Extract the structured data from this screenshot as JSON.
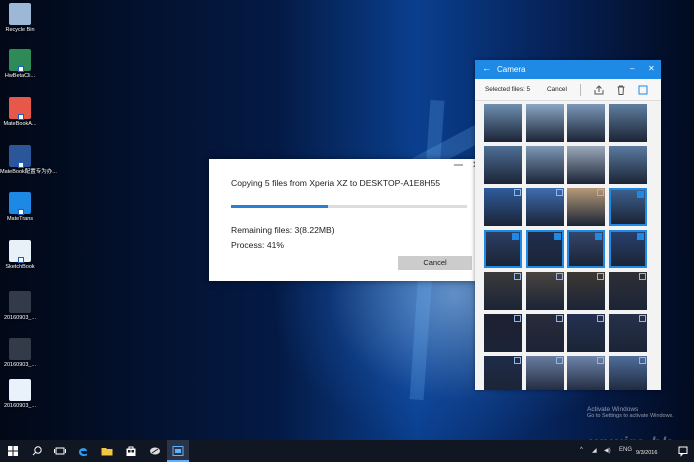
{
  "desktop": {
    "icons": [
      {
        "label": "Recycle Bin",
        "icon": "recycle-bin-icon",
        "color": "#9cb8d6"
      },
      {
        "label": "HwBetaCli...",
        "icon": "app-icon",
        "color": "#2e8b57"
      },
      {
        "label": "MateBookA...",
        "icon": "app-icon",
        "color": "#e8584a"
      },
      {
        "label": "MateBook配置专为办...",
        "icon": "word-document-icon",
        "color": "#2b579a"
      },
      {
        "label": "MateTrans",
        "icon": "app-icon",
        "color": "#1e88e5"
      },
      {
        "label": "SketchBook",
        "icon": "app-icon",
        "color": "#e8f0f8"
      },
      {
        "label": "20160903_...",
        "icon": "photo-icon",
        "color": "#333a48"
      },
      {
        "label": "20160903_...",
        "icon": "photo-icon",
        "color": "#333a48"
      },
      {
        "label": "20160903_...",
        "icon": "image-file-icon",
        "color": "#e9f2fb"
      }
    ]
  },
  "copy_dialog": {
    "title": "Copying 5 files from Xperia XZ to DESKTOP-A1E8H55",
    "progress": 0.41,
    "remaining": "Remaining files: 3(8.22MB)",
    "process": "Process: 41%",
    "cancel_label": "Cancel",
    "close_glyph": "✕"
  },
  "camera_window": {
    "title": "Camera",
    "back_glyph": "←",
    "minimize_glyph": "–",
    "close_glyph": "✕",
    "selected_files": "Selected files: 5",
    "cancel_label": "Cancel",
    "accent": "#1e8ae6",
    "thumbnails": [
      {
        "color": "#6e8fb0",
        "selected": false
      },
      {
        "color": "#8aa7c4",
        "selected": false
      },
      {
        "color": "#7b98b8",
        "selected": false
      },
      {
        "color": "#5f7e9f",
        "selected": false
      },
      {
        "color": "#4e6f96",
        "selected": false
      },
      {
        "color": "#7d97b6",
        "selected": false
      },
      {
        "color": "#9aa9bb",
        "selected": false
      },
      {
        "color": "#5b7aa0",
        "selected": false
      },
      {
        "color": "#2f5c9c",
        "selected": false
      },
      {
        "color": "#3e6db0",
        "selected": false
      },
      {
        "color": "#b59a78",
        "selected": false
      },
      {
        "color": "#3d5f8c",
        "selected": true
      },
      {
        "color": "#2d3f63",
        "selected": true
      },
      {
        "color": "#1f2e4f",
        "selected": true
      },
      {
        "color": "#34466a",
        "selected": true
      },
      {
        "color": "#28406e",
        "selected": true
      },
      {
        "color": "#3b3a3a",
        "selected": false
      },
      {
        "color": "#4a4440",
        "selected": false
      },
      {
        "color": "#3d3834",
        "selected": false
      },
      {
        "color": "#2f2f35",
        "selected": false
      },
      {
        "color": "#1e2030",
        "selected": false
      },
      {
        "color": "#2a2b3b",
        "selected": false
      },
      {
        "color": "#243050",
        "selected": false
      },
      {
        "color": "#26304a",
        "selected": false
      },
      {
        "color": "#1f2c48",
        "selected": false
      },
      {
        "color": "#6a7da0",
        "selected": false
      },
      {
        "color": "#6e84aa",
        "selected": false
      },
      {
        "color": "#4f6d9a",
        "selected": false
      }
    ]
  },
  "watermark": {
    "activate_title": "Activate Windows",
    "activate_sub": "Go to Settings to activate Windows.",
    "brand": "unwire.hk"
  },
  "taskbar": {
    "date": "9/3/2016",
    "tray_text": "ENG"
  }
}
